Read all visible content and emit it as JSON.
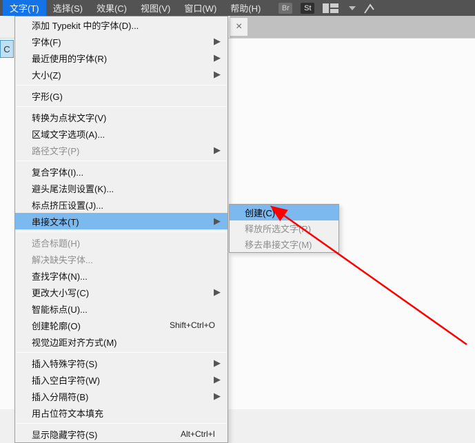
{
  "menubar": {
    "items": [
      {
        "label": "文字(T)",
        "active": true
      },
      {
        "label": "选择(S)"
      },
      {
        "label": "效果(C)"
      },
      {
        "label": "视图(V)"
      },
      {
        "label": "窗口(W)"
      },
      {
        "label": "帮助(H)"
      }
    ],
    "icons": {
      "br": "Br",
      "st": "St"
    }
  },
  "tab": {
    "close": "×"
  },
  "leftpad": "C",
  "dropdown": {
    "items": [
      {
        "label": "添加 Typekit 中的字体(D)..."
      },
      {
        "label": "字体(F)",
        "arrow": true
      },
      {
        "label": "最近使用的字体(R)",
        "arrow": true
      },
      {
        "label": "大小(Z)",
        "arrow": true
      },
      {
        "sep": true
      },
      {
        "label": "字形(G)"
      },
      {
        "sep": true
      },
      {
        "label": "转换为点状文字(V)"
      },
      {
        "label": "区域文字选项(A)..."
      },
      {
        "label": "路径文字(P)",
        "arrow": true,
        "disabled": true
      },
      {
        "sep": true
      },
      {
        "label": "复合字体(I)..."
      },
      {
        "label": "避头尾法则设置(K)..."
      },
      {
        "label": "标点挤压设置(J)..."
      },
      {
        "label": "串接文本(T)",
        "arrow": true,
        "highlight": true
      },
      {
        "sep": true
      },
      {
        "label": "适合标题(H)",
        "disabled": true
      },
      {
        "label": "解决缺失字体...",
        "disabled": true
      },
      {
        "label": "查找字体(N)..."
      },
      {
        "label": "更改大小写(C)",
        "arrow": true
      },
      {
        "label": "智能标点(U)..."
      },
      {
        "label": "创建轮廓(O)",
        "shortcut": "Shift+Ctrl+O"
      },
      {
        "label": "视觉边距对齐方式(M)"
      },
      {
        "sep": true
      },
      {
        "label": "插入特殊字符(S)",
        "arrow": true
      },
      {
        "label": "插入空白字符(W)",
        "arrow": true
      },
      {
        "label": "插入分隔符(B)",
        "arrow": true
      },
      {
        "label": "用占位符文本填充"
      },
      {
        "sep": true
      },
      {
        "label": "显示隐藏字符(S)",
        "shortcut": "Alt+Ctrl+I"
      }
    ]
  },
  "submenu": {
    "items": [
      {
        "label": "创建(C)",
        "highlight": true
      },
      {
        "label": "释放所选文字(R)",
        "disabled": true
      },
      {
        "label": "移去串接文字(M)",
        "disabled": true
      }
    ]
  }
}
